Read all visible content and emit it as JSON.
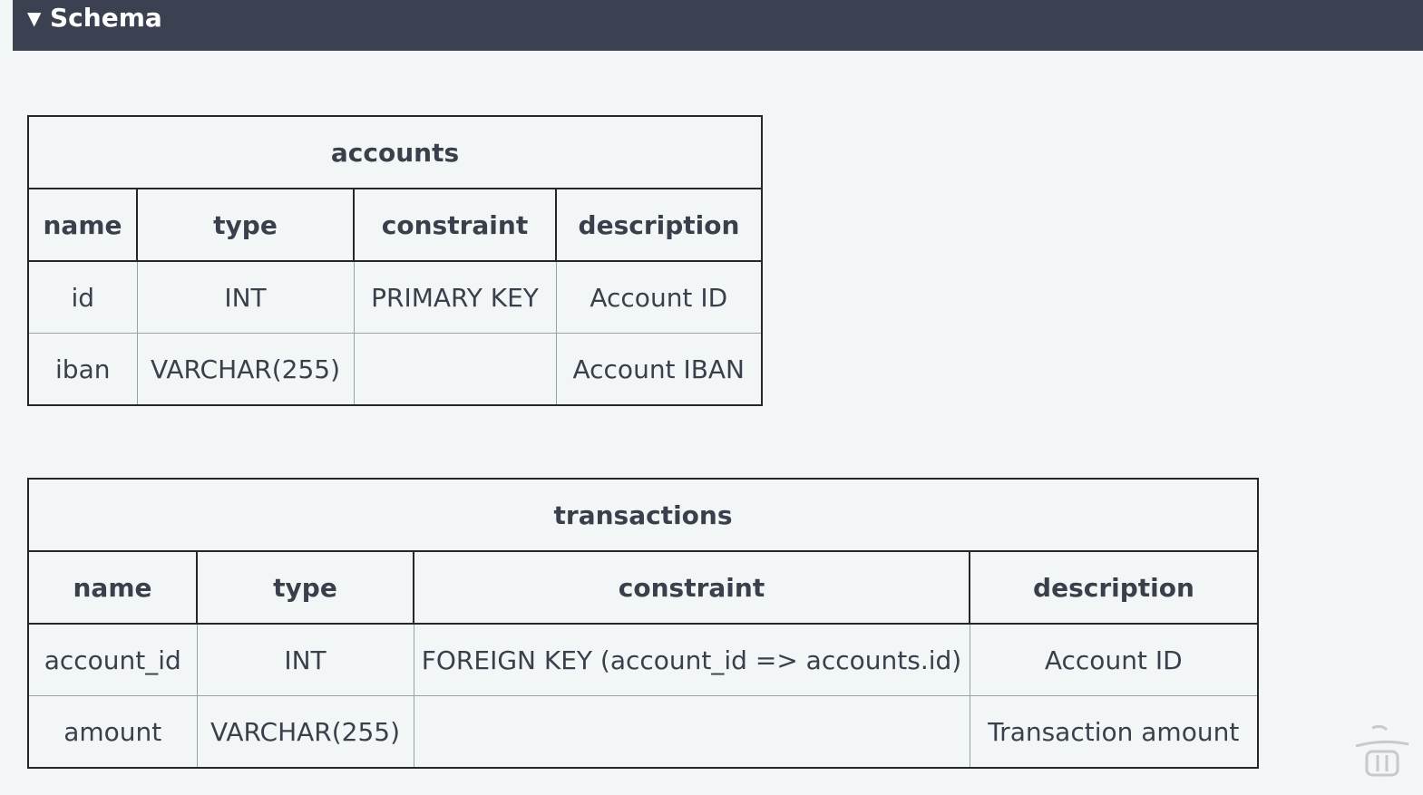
{
  "header": {
    "toggle_glyph": "▼",
    "title": "Schema"
  },
  "accounts": {
    "name": "accounts",
    "columns": [
      "name",
      "type",
      "constraint",
      "description"
    ],
    "rows": [
      [
        "id",
        "INT",
        "PRIMARY KEY",
        "Account ID"
      ],
      [
        "iban",
        "VARCHAR(255)",
        "",
        "Account IBAN"
      ]
    ]
  },
  "transactions": {
    "name": "transactions",
    "columns": [
      "name",
      "type",
      "constraint",
      "description"
    ],
    "rows": [
      [
        "account_id",
        "INT",
        "FOREIGN KEY (account_id => accounts.id)",
        "Account ID"
      ],
      [
        "amount",
        "VARCHAR(255)",
        "",
        "Transaction amount"
      ]
    ]
  },
  "colors": {
    "header_bg": "#3b4150",
    "page_bg": "#f3f6f7",
    "text": "#3a3f4b",
    "border": "#23262e"
  }
}
